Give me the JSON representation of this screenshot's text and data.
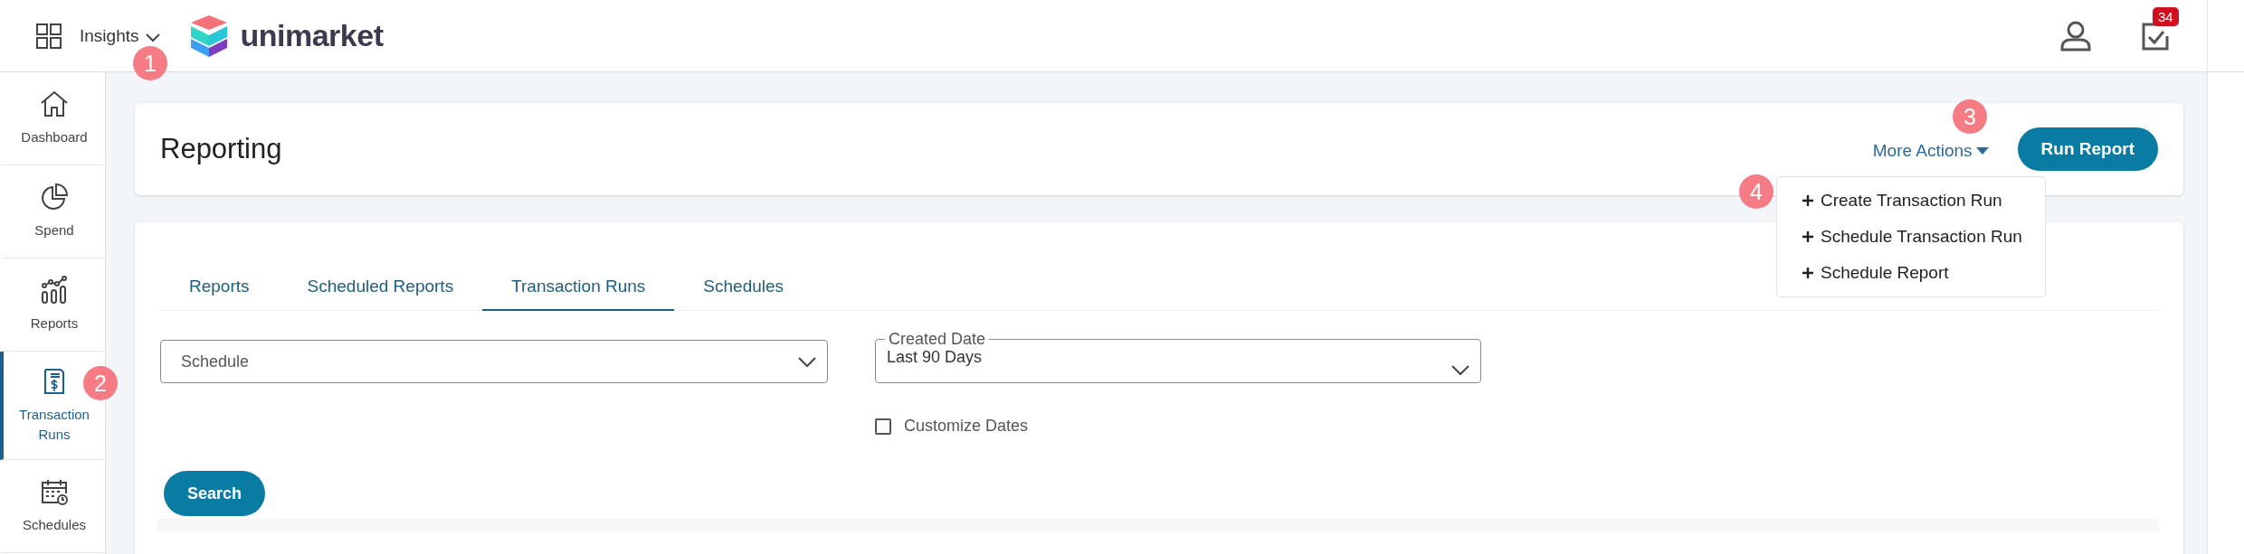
{
  "header": {
    "app_menu": "Insights",
    "logo": "unimarket",
    "notification_count": "34"
  },
  "sidebar": {
    "items": [
      {
        "label": "Dashboard",
        "selected": false
      },
      {
        "label": "Spend",
        "selected": false
      },
      {
        "label": "Reports",
        "selected": false
      },
      {
        "label": "Transaction Runs",
        "selected": true
      },
      {
        "label": "Schedules",
        "selected": false
      }
    ]
  },
  "page": {
    "title": "Reporting",
    "more_actions": "More Actions",
    "run_button": "Run Report",
    "menu": [
      {
        "label": "Create Transaction Run"
      },
      {
        "label": "Schedule Transaction Run"
      },
      {
        "label": "Schedule Report"
      }
    ]
  },
  "tabs": [
    {
      "label": "Reports",
      "selected": false
    },
    {
      "label": "Scheduled Reports",
      "selected": false
    },
    {
      "label": "Transaction Runs",
      "selected": true
    },
    {
      "label": "Schedules",
      "selected": false
    }
  ],
  "filters": {
    "schedule": {
      "placeholder": "Schedule"
    },
    "created_date": {
      "label": "Created Date",
      "value": "Last 90 Days"
    },
    "customize_dates": {
      "label": "Customize Dates",
      "checked": false
    },
    "search_button": "Search"
  },
  "annotations": [
    "1",
    "2",
    "3",
    "4"
  ]
}
